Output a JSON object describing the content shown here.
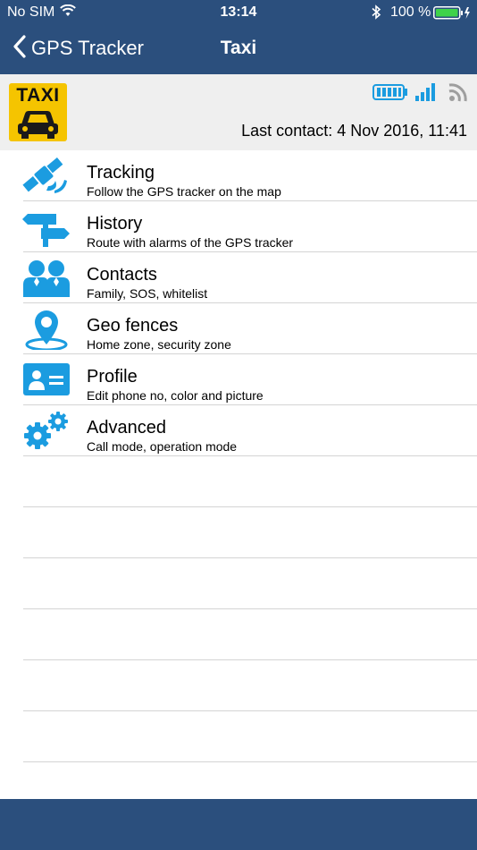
{
  "status_bar": {
    "carrier": "No SIM",
    "time": "13:14",
    "battery_percent": "100 %"
  },
  "nav": {
    "back_label": "GPS Tracker",
    "title": "Taxi"
  },
  "device": {
    "logo_text": "TAXI",
    "last_contact": "Last contact: 4 Nov 2016, 11:41"
  },
  "menu": {
    "items": [
      {
        "title": "Tracking",
        "subtitle": "Follow the GPS tracker on the map",
        "icon": "satellite-icon"
      },
      {
        "title": "History",
        "subtitle": "Route with alarms of the GPS tracker",
        "icon": "signpost-icon"
      },
      {
        "title": "Contacts",
        "subtitle": "Family, SOS, whitelist",
        "icon": "contacts-icon"
      },
      {
        "title": "Geo fences",
        "subtitle": "Home zone, security zone",
        "icon": "location-pin-icon"
      },
      {
        "title": "Profile",
        "subtitle": "Edit phone no, color and picture",
        "icon": "id-card-icon"
      },
      {
        "title": "Advanced",
        "subtitle": "Call mode, operation mode",
        "icon": "gears-icon"
      }
    ]
  },
  "colors": {
    "navbar": "#2b4f7d",
    "accent": "#1b9ce0",
    "header_bg": "#efefef",
    "divider": "#d4d4d4"
  }
}
